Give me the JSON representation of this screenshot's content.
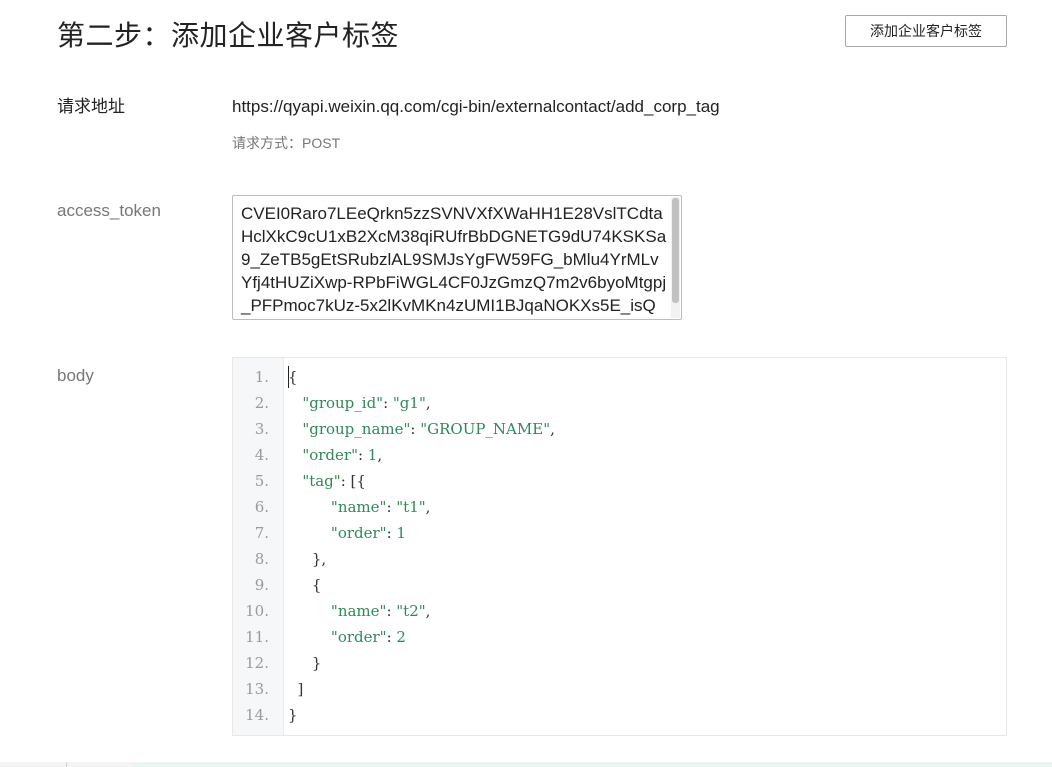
{
  "header": {
    "title": "第二步：添加企业客户标签",
    "action_button_label": "添加企业客户标签"
  },
  "request": {
    "url_label": "请求地址",
    "url": "https://qyapi.weixin.qq.com/cgi-bin/externalcontact/add_corp_tag",
    "method": "请求方式：POST"
  },
  "access_token": {
    "label": "access_token",
    "value": "CVEI0Raro7LEeQrkn5zzSVNVXfXWaHH1E28VslTCdtaHclXkC9cU1xB2XcM38qiRUfrBbDGNETG9dU74KSKSa9_ZeTB5gEtSRubzlAL9SMJsYgFW59FG_bMlu4YrMLvYfj4tHUZiXwp-RPbFiWGL4CF0JzGmzQ7m2v6byoMtgpj_PFPmoc7kUz-5x2lKvMKn4zUMI1BJqaNOKXs5E_isQ"
  },
  "body": {
    "label": "body",
    "line_numbers": [
      "1.",
      "2.",
      "3.",
      "4.",
      "5.",
      "6.",
      "7.",
      "8.",
      "9.",
      "10.",
      "11.",
      "12.",
      "13.",
      "14."
    ],
    "lines": [
      "{",
      "   \"group_id\": \"g1\",",
      "   \"group_name\": \"GROUP_NAME\",",
      "   \"order\": 1,",
      "   \"tag\": [{",
      "         \"name\": \"t1\",",
      "         \"order\": 1",
      "     },",
      "     {",
      "         \"name\": \"t2\",",
      "         \"order\": 2",
      "     }",
      "  ]",
      "}"
    ]
  },
  "colors": {
    "code_key": "#2e8b57",
    "text": "#222222",
    "muted": "#777777"
  }
}
